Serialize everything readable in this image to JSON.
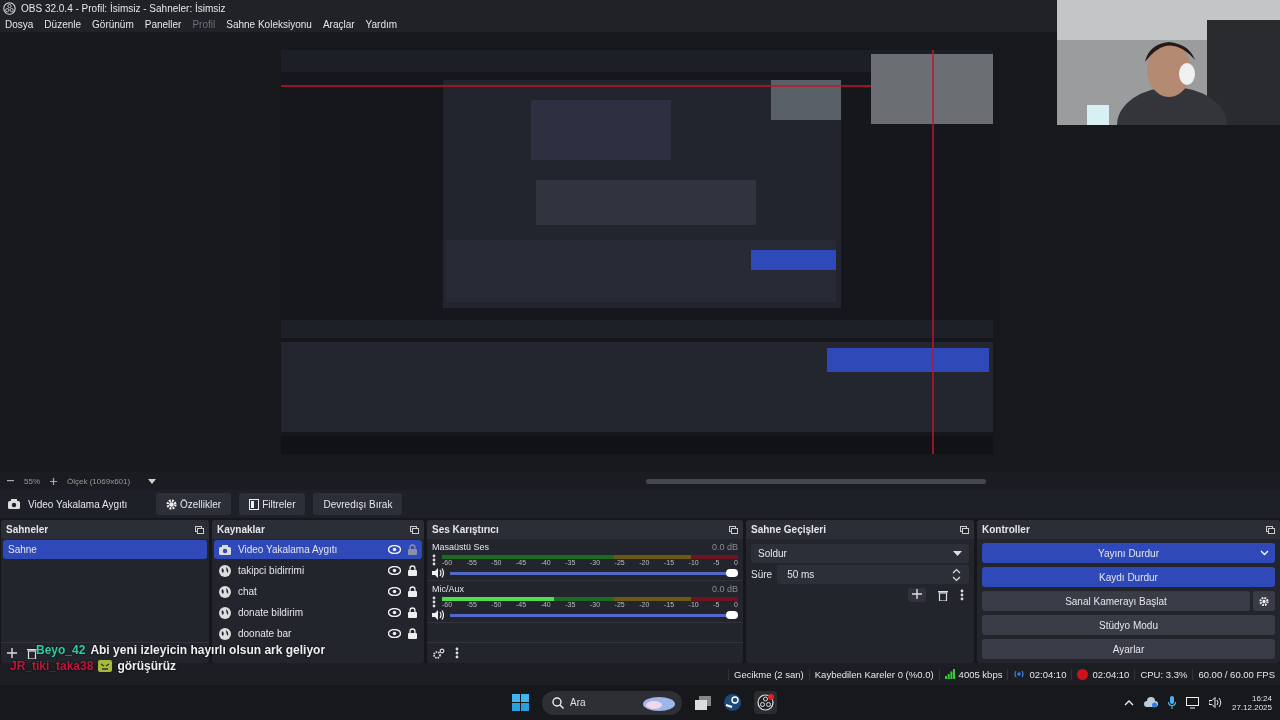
{
  "window": {
    "title": "OBS 32.0.4 - Profil: İsimsiz - Sahneler: İsimsiz"
  },
  "menu": [
    {
      "label": "Dosya",
      "disabled": false
    },
    {
      "label": "Düzenle",
      "disabled": false
    },
    {
      "label": "Görünüm",
      "disabled": false
    },
    {
      "label": "Paneller",
      "disabled": false
    },
    {
      "label": "Profil",
      "disabled": true
    },
    {
      "label": "Sahne Koleksiyonu",
      "disabled": false
    },
    {
      "label": "Araçlar",
      "disabled": false
    },
    {
      "label": "Yardım",
      "disabled": false
    }
  ],
  "zoom_bar": {
    "zoom": "55%",
    "scale": "Ölçek (1069x601)"
  },
  "source_toolbar": {
    "source": "Video Yakalama Aygıtı",
    "buttons": [
      {
        "label": "Özellikler",
        "kind": "gear"
      },
      {
        "label": "Filtreler",
        "kind": "filter"
      },
      {
        "label": "Devredışı Bırak",
        "kind": "plain"
      }
    ]
  },
  "scenes": {
    "title": "Sahneler",
    "items": [
      {
        "label": "Sahne",
        "selected": true
      }
    ]
  },
  "sources": {
    "title": "Kaynaklar",
    "items": [
      {
        "label": "Video Yakalama Aygıtı",
        "kind": "camera",
        "selected": true
      },
      {
        "label": "takipci bidirrimi",
        "kind": "browser",
        "selected": false
      },
      {
        "label": "chat",
        "kind": "browser",
        "selected": false
      },
      {
        "label": "donate bildirim",
        "kind": "browser",
        "selected": false
      },
      {
        "label": "doonate bar",
        "kind": "browser",
        "selected": false
      }
    ]
  },
  "mixer": {
    "title": "Ses Karıştırıcı",
    "channels": [
      {
        "name": "Masaüstü Ses",
        "reading": "0.0 dB",
        "volume": {
          "level": 1
        },
        "ticks": [
          "-60",
          "-55",
          "-50",
          "-45",
          "-40",
          "-35",
          "-30",
          "-25",
          "-20",
          "-15",
          "-10",
          "-5",
          "0"
        ]
      },
      {
        "name": "Mic/Aux",
        "reading": "0.0 dB",
        "level": 0.38,
        "volume": {
          "level": 1
        },
        "ticks": [
          "-60",
          "-55",
          "-50",
          "-45",
          "-40",
          "-35",
          "-30",
          "-25",
          "-20",
          "-15",
          "-10",
          "-5",
          "0"
        ]
      }
    ]
  },
  "transitions": {
    "title": "Sahne Geçişleri",
    "transition": "Soldur",
    "duration_label": "Süre",
    "duration": "50 ms"
  },
  "controls": {
    "title": "Kontroller",
    "buttons": [
      {
        "label": "Yayını Durdur",
        "kind": "active-menu"
      },
      {
        "label": "Kaydı Durdur",
        "kind": "active"
      },
      {
        "label": "Sanal Kamerayı Başlat",
        "kind": "settings"
      },
      {
        "label": "Stüdyo Modu",
        "kind": "plain"
      },
      {
        "label": "Ayarlar",
        "kind": "plain"
      }
    ]
  },
  "chat_overlay": [
    {
      "user": "Beyo_42",
      "color": "#2ccf9e",
      "message": "Abi yeni izleyicin hayırlı olsun ark geliyor",
      "emote": false
    },
    {
      "user": "JR_tiki_taka38",
      "color": "#c8143c",
      "message": "görüşürüz",
      "emote": true
    }
  ],
  "status_bar": [
    {
      "text": "Gecikme (2 san)",
      "kind": "plain"
    },
    {
      "text": "Kaybedilen Kareler 0 (%0.0)",
      "kind": "plain"
    },
    {
      "text": "4005 kbps",
      "kind": "bitrate"
    },
    {
      "text": "02:04:10",
      "kind": "stream"
    },
    {
      "text": "02:04:10",
      "kind": "record"
    },
    {
      "text": "CPU: 3.3%",
      "kind": "plain"
    },
    {
      "text": "60.00 / 60.00 FPS",
      "kind": "plain"
    }
  ],
  "taskbar": {
    "search": {
      "placeholder": "Ara"
    },
    "time": "16:24",
    "date": "27.12.2025"
  }
}
